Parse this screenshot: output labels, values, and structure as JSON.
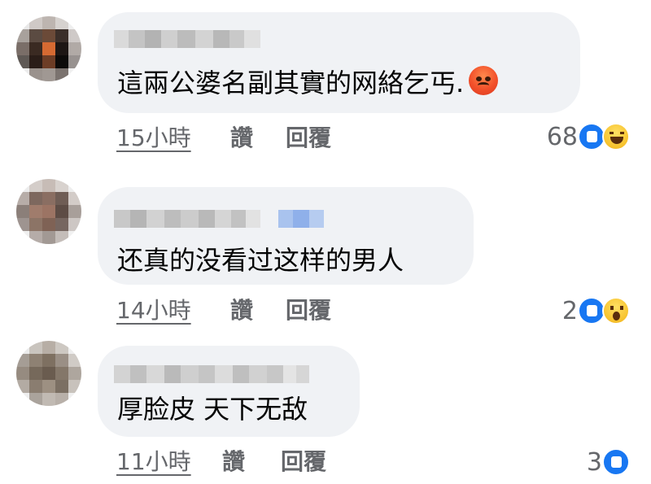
{
  "comments": [
    {
      "text": "這兩公婆名副其實的网絡乞丐.",
      "emoji": "angry-face-emoji",
      "time": "15小時",
      "like_label": "讚",
      "reply_label": "回覆",
      "reaction_count": "68",
      "reactions": [
        "like",
        "haha"
      ]
    },
    {
      "text": "还真的没看过这样的男人",
      "time": "14小時",
      "like_label": "讚",
      "reply_label": "回覆",
      "reaction_count": "2",
      "reactions": [
        "like",
        "wow"
      ]
    },
    {
      "text": "厚脸皮 天下无敌",
      "time": "11小時",
      "like_label": "讚",
      "reply_label": "回覆",
      "reaction_count": "3",
      "reactions": [
        "like"
      ]
    }
  ],
  "colors": {
    "bubble": "#f0f2f5",
    "meta_text": "#65676b",
    "like_blue": "#1877f2"
  }
}
